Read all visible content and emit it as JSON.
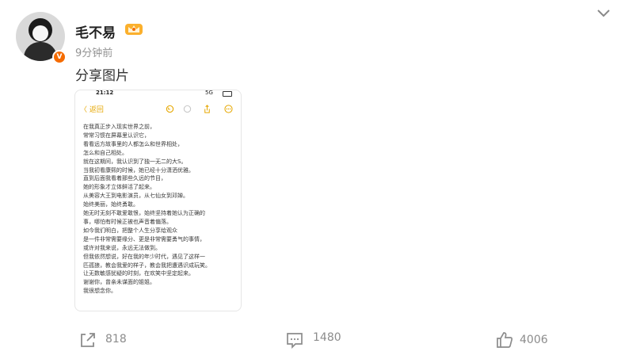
{
  "post": {
    "author": "毛不易",
    "time": "9分钟前",
    "text": "分享图片",
    "verified_badge": "V"
  },
  "image": {
    "status_time": "21:12",
    "status_signal": "5G",
    "back_label": "〈 返回",
    "lines": [
      "在我真正步入现实世界之前，",
      "常常习惯在屏幕里认识它，",
      "看看远方故事里的人都怎么和世界相处，",
      "怎么和自己相处。",
      "就在这期间，我认识到了独一无二的大S。",
      "当我初看康熙的时候，她已经十分潇洒优雅。",
      "直到后面我看着那些久远的节目，",
      "她的形象才立体鲜活了起来。",
      "从美容大王到电影演员，从七仙女到邓婵。",
      "始终美丽，始终勇敢。",
      "她无时无刻不敢爱敢恨，始终坚持着她认为正确的",
      "事，哪怕有时候正被也声音着偏落。",
      "如今我们明白，把整个人生分享给观众",
      "是一件非常需要缘分、更是非常需要勇气的事情，",
      "或许对我来说，永远无法做到。",
      "但我依然想说，好在我的年少时代，遇见了这样一",
      "匹孤狼，教会我爱的样子，教会我把遭遇识成玩笑。",
      "让无数敏感犹疑的时刻，在欢笑中坚定起来。",
      "谢谢你，曾亲未谋面的姐姐。",
      "我很想念你。"
    ]
  },
  "actions": {
    "share_count": "818",
    "comment_count": "1480",
    "like_count": "4006"
  },
  "colors": {
    "accent_orange": "#f56b00",
    "phone_accent": "#e6a700",
    "muted_text": "#8c8c8c"
  },
  "icons": [
    "user-avatar",
    "verified-badge-icon",
    "vip-crown-icon",
    "chevron-down-icon",
    "share-icon",
    "comment-icon",
    "like-icon"
  ]
}
